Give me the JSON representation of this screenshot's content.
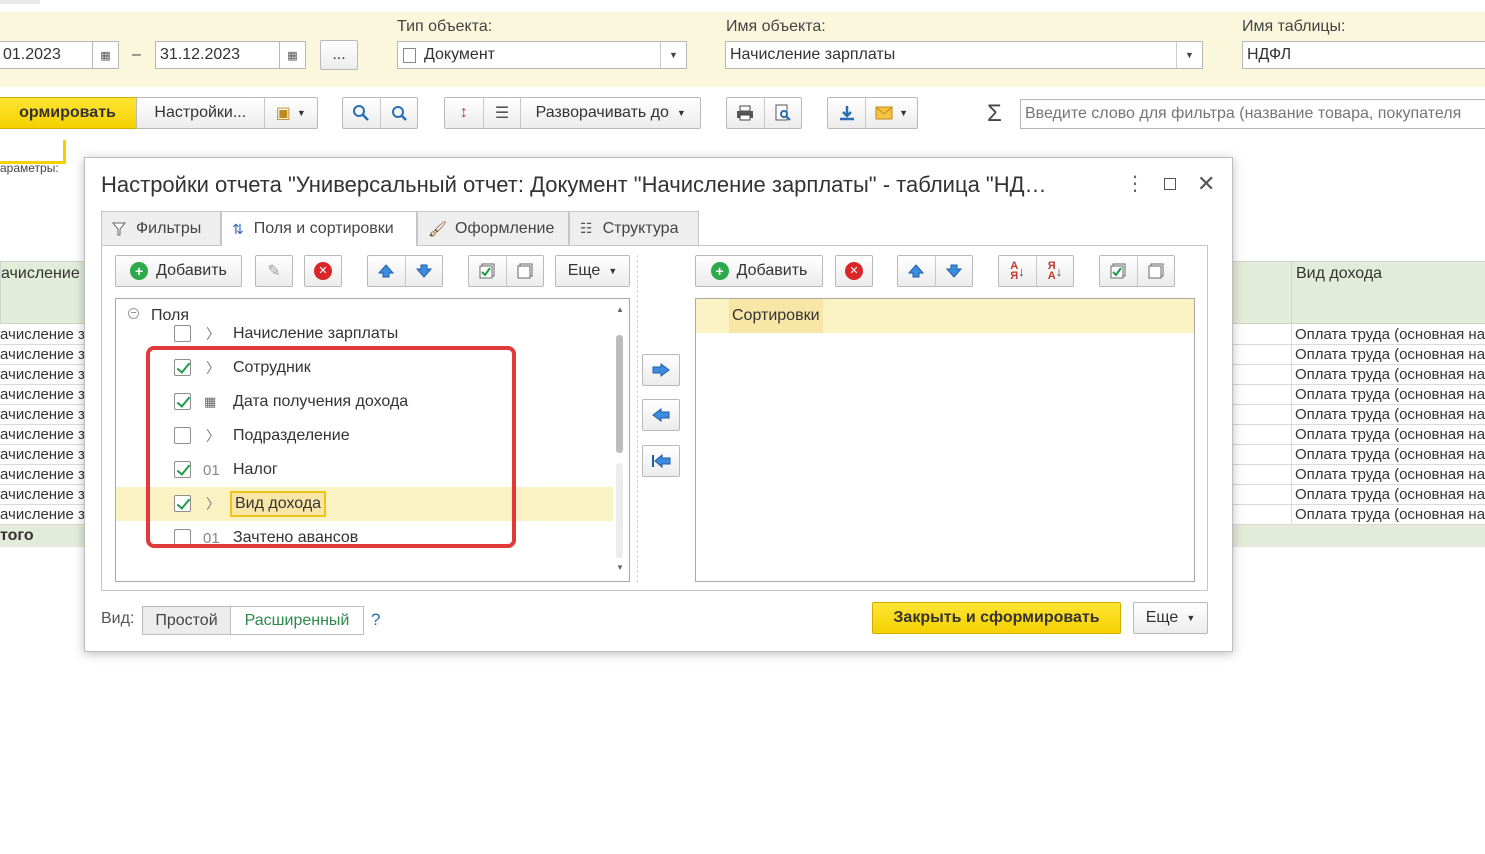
{
  "header": {
    "date_from": "01.2023",
    "date_sep": "–",
    "date_to": "31.12.2023",
    "more_btn": "...",
    "object_type_label": "Тип объекта:",
    "object_type_value": "Документ",
    "object_name_label": "Имя объекта:",
    "object_name_value": "Начисление зарплаты",
    "table_name_label": "Имя таблицы:",
    "table_name_value": "НДФЛ"
  },
  "toolbar": {
    "generate": "ормировать",
    "settings": "Настройки...",
    "expand_to": "Разворачивать до",
    "sigma": "Σ",
    "filter_placeholder": "Введите слово для фильтра (название товара, покупателя"
  },
  "background": {
    "params_label": "араметры:",
    "col1_header": "ачисление",
    "col2_header": "Вид дохода",
    "col1_rows": [
      "ачисление зар",
      "ачисление зар",
      "ачисление зар",
      "ачисление зар",
      "ачисление зар",
      "ачисление зар",
      "ачисление зар",
      "ачисление зар",
      "ачисление зар",
      "ачисление зар"
    ],
    "col2_rows": [
      "Оплата труда (основная нал",
      "Оплата труда (основная нал",
      "Оплата труда (основная нал",
      "Оплата труда (основная нал",
      "Оплата труда (основная нал",
      "Оплата труда (основная нал",
      "Оплата труда (основная нал",
      "Оплата труда (основная нал",
      "Оплата труда (основная нал",
      "Оплата труда (основная нал"
    ],
    "total": "того"
  },
  "dialog": {
    "title": "Настройки отчета \"Универсальный отчет: Документ \"Начисление зарплаты\" - таблица \"НД…",
    "tabs": [
      "Фильтры",
      "Поля и сортировки",
      "Оформление",
      "Структура"
    ],
    "left_add": "Добавить",
    "left_more": "Еще",
    "right_add": "Добавить",
    "tree_root": "Поля",
    "fields": [
      {
        "label": "Начисление зарплаты",
        "checked": false,
        "kind": "chevron"
      },
      {
        "label": "Сотрудник",
        "checked": true,
        "kind": "chevron"
      },
      {
        "label": "Дата получения дохода",
        "checked": true,
        "kind": "calendar"
      },
      {
        "label": "Подразделение",
        "checked": false,
        "kind": "chevron"
      },
      {
        "label": "Налог",
        "checked": true,
        "kind": "number",
        "kind_label": "01"
      },
      {
        "label": "Вид дохода",
        "checked": true,
        "kind": "chevron"
      },
      {
        "label": "Зачтено авансов",
        "checked": false,
        "kind": "number",
        "kind_label": "01"
      }
    ],
    "sort_header": "Сортировки",
    "view_label": "Вид:",
    "view_simple": "Простой",
    "view_extended": "Расширенный",
    "help": "?",
    "close_generate": "Закрыть и сформировать",
    "more": "Еще"
  },
  "colors": {
    "accent_yellow": "#f5d100",
    "header_band": "#fbf7dc",
    "selection": "#fbf2c3",
    "annotation_red": "#e03a3a",
    "check_green": "#1d9b45"
  }
}
